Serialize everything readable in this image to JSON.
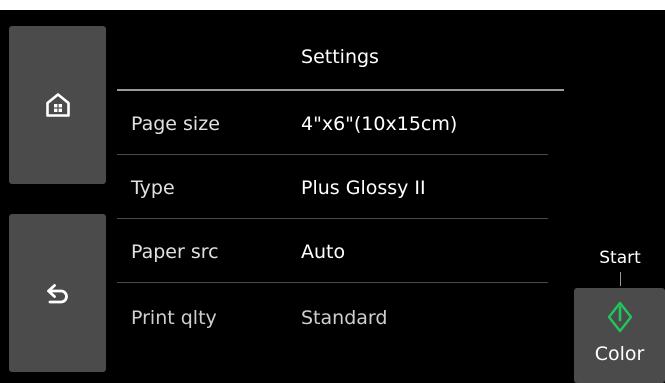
{
  "header": {
    "title": "Settings"
  },
  "nav": {
    "home_icon": "home-icon",
    "back_icon": "back-icon"
  },
  "settings": [
    {
      "label": "Page size",
      "value": "4\"x6\"(10x15cm)"
    },
    {
      "label": "Type",
      "value": "Plus Glossy II"
    },
    {
      "label": "Paper src",
      "value": "Auto"
    },
    {
      "label": "Print qlty",
      "value": "Standard"
    }
  ],
  "start": {
    "label": "Start",
    "button_label": "Color",
    "icon": "start-diamond-icon"
  },
  "colors": {
    "screen_bg": "#000000",
    "button_bg": "#4b4b4b",
    "accent_green": "#22c55e",
    "text": "#ffffff"
  }
}
